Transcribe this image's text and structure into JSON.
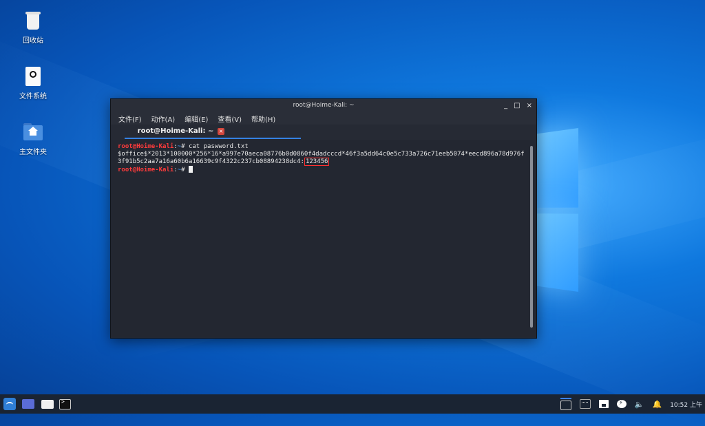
{
  "desktop": {
    "icons": [
      {
        "label": "回收站",
        "icon": "trash-icon"
      },
      {
        "label": "文件系统",
        "icon": "drive-icon"
      },
      {
        "label": "主文件夹",
        "icon": "home-folder-icon"
      }
    ]
  },
  "terminal": {
    "window_title": "root@Hoime-Kali: ~",
    "controls": {
      "minimize": "_",
      "maximize": "□",
      "close": "×"
    },
    "menu": [
      "文件(F)",
      "动作(A)",
      "编辑(E)",
      "查看(V)",
      "帮助(H)"
    ],
    "tab_title": "root@Hoime-Kali: ~",
    "tab_close": "×",
    "lines": {
      "prompt_user": "root@Hoime-Kali",
      "prompt_sep": ":",
      "prompt_path": "~",
      "prompt_hash": "# ",
      "command": "cat paswword.txt",
      "hash_line1": "$office$*2013*100000*256*16*a997e70aeca08776b0d0860f4dadcccd*46f3a5dd64c0e5c733a726c71eeb5074*eecd896a78d976f",
      "hash_line2_prefix": "3f91b5c2aa7a16a60b6a16639c9f4322c237cb08894238dc4:",
      "password": "123456"
    }
  },
  "taskbar": {
    "items": [
      "start-menu-icon",
      "show-desktop-icon",
      "file-manager-icon",
      "terminal-icon"
    ],
    "tray": {
      "clock": "10:52 上午"
    }
  },
  "colors": {
    "prompt_user": "#ff3b3b",
    "prompt_path": "#4aa3ff",
    "highlight_box": "#ff3030",
    "tab_accent": "#3582e4"
  }
}
